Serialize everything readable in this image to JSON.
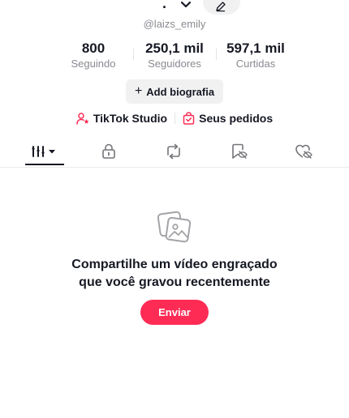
{
  "profile": {
    "name_partial": ".",
    "handle": "@laizs_emily"
  },
  "stats": [
    {
      "value": "800",
      "label": "Seguindo"
    },
    {
      "value": "250,1 mil",
      "label": "Seguidores"
    },
    {
      "value": "597,1 mil",
      "label": "Curtidas"
    }
  ],
  "bio_button": {
    "plus": "+",
    "label": "Add biografia"
  },
  "links": {
    "studio": "TikTok Studio",
    "orders": "Seus pedidos"
  },
  "tabs": [
    "videos-grid",
    "private-lock",
    "reposts",
    "favorites",
    "liked"
  ],
  "empty_state": {
    "line1": "Compartilhe um vídeo engraçado",
    "line2": "que você gravou recentemente",
    "button": "Enviar"
  },
  "colors": {
    "accent": "#fe2c55",
    "text": "#161823",
    "muted": "#8a8b91"
  }
}
